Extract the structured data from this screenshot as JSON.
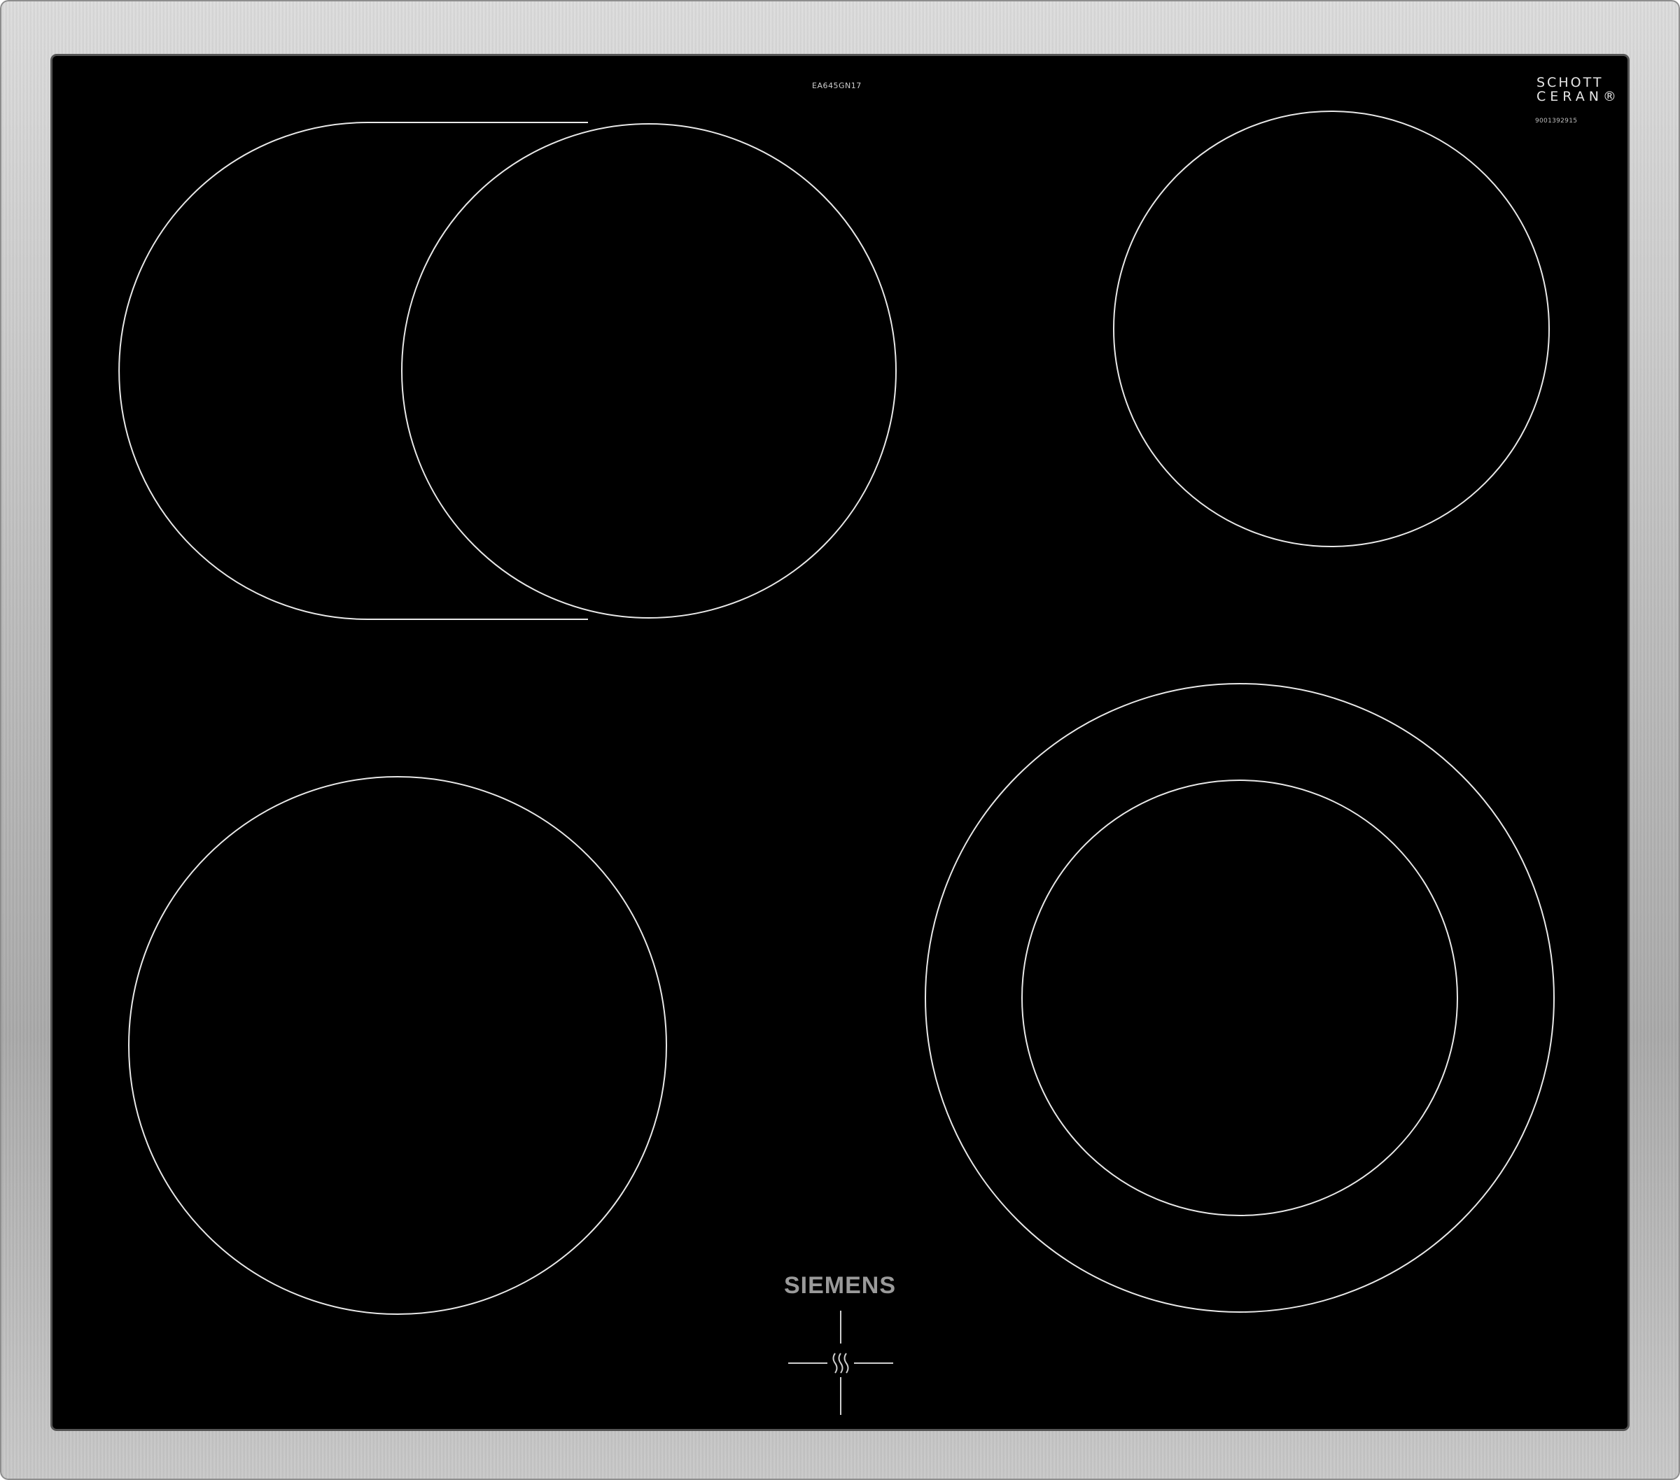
{
  "product": {
    "model_code": "EA645GN17",
    "glass_brand_line1": "SCHOTT",
    "glass_brand_line2": "CERAN",
    "registered_mark": "®",
    "serial_number": "9001392915",
    "manufacturer": "SIEMENS"
  },
  "icons": {
    "heat_indicator": "heat-waves-icon"
  },
  "colors": {
    "glass": "#000000",
    "zone_outline": "#e8e8e8",
    "frame": "#bdbdbd",
    "brand_text": "#9a9a9a"
  }
}
